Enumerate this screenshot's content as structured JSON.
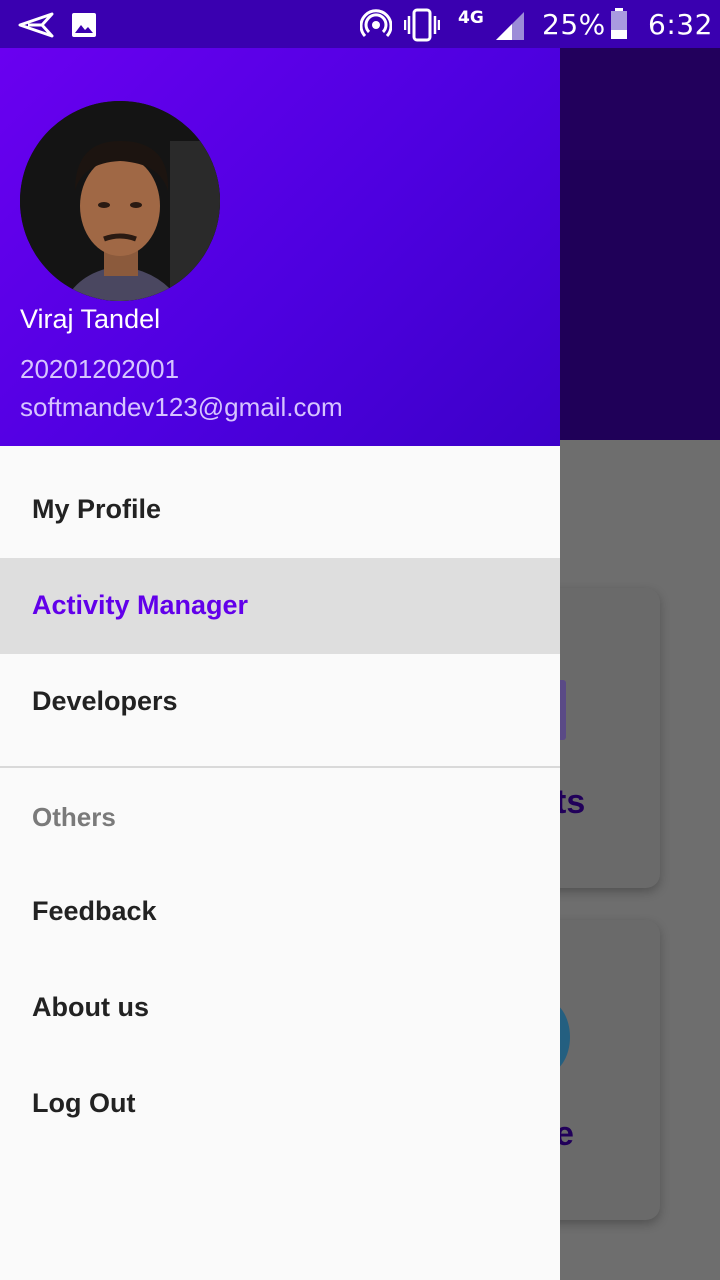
{
  "status_bar": {
    "battery": "25%",
    "time": "6:32",
    "network": "4G",
    "icons": [
      "send-icon",
      "image-icon",
      "hotspot-icon",
      "vibrate-icon",
      "signal-icon",
      "battery-icon"
    ]
  },
  "drawer": {
    "header": {
      "name": "Viraj Tandel",
      "id": "20201202001",
      "email": "softmandev123@gmail.com"
    },
    "items": [
      {
        "label": "My Profile"
      },
      {
        "label": "Activity Manager",
        "active": true
      },
      {
        "label": "Developers"
      }
    ],
    "section_title": "Others",
    "other_items": [
      {
        "label": "Feedback"
      },
      {
        "label": "About us"
      },
      {
        "label": "Log Out"
      }
    ]
  },
  "background": {
    "card1_text_partial": "ts",
    "card2_text_partial": "e"
  },
  "colors": {
    "accent": "#6200ea",
    "status_bar": "#3a00b0",
    "header_gradient_start": "#6a00f0",
    "header_gradient_end": "#3c00c8"
  }
}
